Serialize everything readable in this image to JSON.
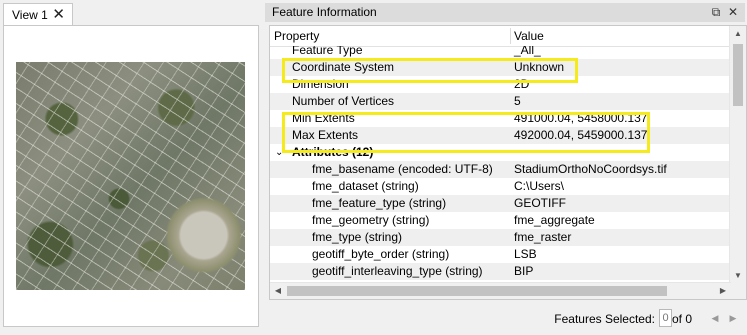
{
  "view": {
    "tab_label": "View 1",
    "close_glyph": "✕"
  },
  "feature_panel": {
    "title": "Feature Information",
    "float_glyph": "⧉",
    "close_glyph": "✕",
    "columns": {
      "property": "Property",
      "value": "Value"
    },
    "rows": [
      {
        "property": "Feature Type",
        "value": "_All_",
        "alt": false
      },
      {
        "property": "Coordinate System",
        "value": "Unknown",
        "alt": true
      },
      {
        "property": "Dimension",
        "value": "2D",
        "alt": false
      },
      {
        "property": "Number of Vertices",
        "value": "5",
        "alt": true
      },
      {
        "property": "Min Extents",
        "value": "491000.04, 5458000.137",
        "alt": false
      },
      {
        "property": "Max Extents",
        "value": "492000.04, 5459000.137",
        "alt": true
      }
    ],
    "attributes_group": {
      "label": "Attributes (12)",
      "expander_glyph": "⌄"
    },
    "attributes": [
      {
        "property": "fme_basename (encoded: UTF-8)",
        "value": "StadiumOrthoNoCoordsys.tif"
      },
      {
        "property": "fme_dataset (string)",
        "value": "C:\\Users\\"
      },
      {
        "property": "fme_feature_type (string)",
        "value": "GEOTIFF"
      },
      {
        "property": "fme_geometry (string)",
        "value": "fme_aggregate"
      },
      {
        "property": "fme_type (string)",
        "value": "fme_raster"
      },
      {
        "property": "geotiff_byte_order (string)",
        "value": "LSB"
      },
      {
        "property": "geotiff_interleaving_type (string)",
        "value": "BIP"
      }
    ]
  },
  "status": {
    "label": "Features Selected:",
    "selected_value": "0",
    "of_text": "of 0",
    "prev_glyph": "◀",
    "next_glyph": "▶"
  },
  "colors": {
    "highlight": "#f5ea1c",
    "title_bar": "#dcdcdc",
    "row_alt": "#efefef"
  }
}
